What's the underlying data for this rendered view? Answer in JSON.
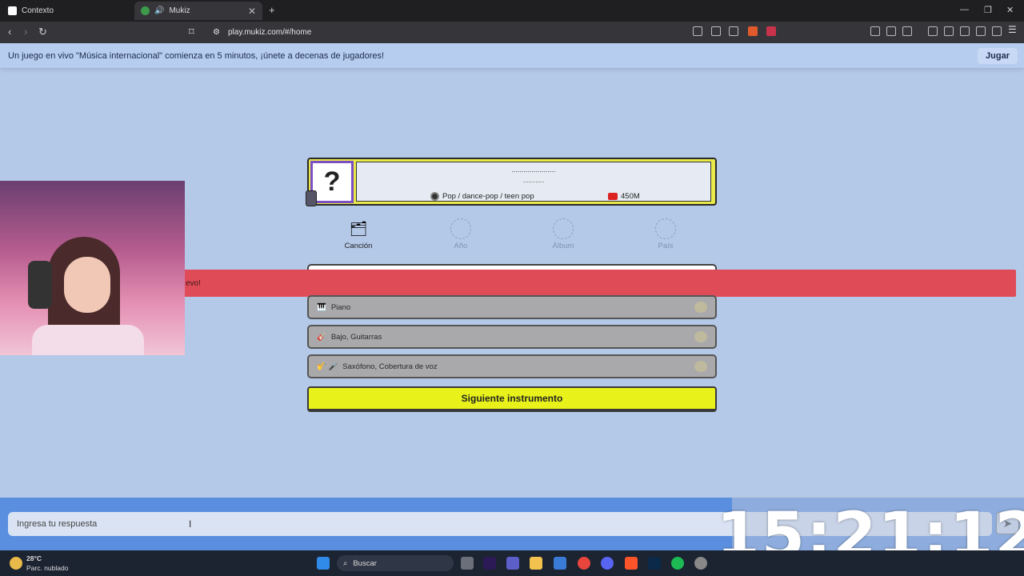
{
  "browser": {
    "tabs": [
      {
        "label": "Contexto",
        "active": false
      },
      {
        "label": "Mukiz",
        "active": true
      }
    ],
    "new_tab": "+",
    "url": "play.mukiz.com/#/home"
  },
  "banner": {
    "text": "Un juego en vivo \"Música internacional\" comienza en 5 minutos, ¡únete a decenas de jugadores!",
    "button": "Jugar"
  },
  "song": {
    "mystery": "?",
    "title_hidden": "......................",
    "artist_hidden": "............",
    "genre": "Pop / dance-pop / teen pop",
    "views": "450M"
  },
  "categories": [
    {
      "label": "Canción",
      "state": "revealed"
    },
    {
      "label": "Año",
      "state": "locked"
    },
    {
      "label": "Álbum",
      "state": "locked"
    },
    {
      "label": "País",
      "state": "locked"
    }
  ],
  "alert": {
    "text": "evo!"
  },
  "instruments": [
    {
      "label": "Piano",
      "icon": "🎹"
    },
    {
      "label": "Bajo, Guitarras",
      "icon": "🎸"
    },
    {
      "label": "Saxófono, Cobertura de voz",
      "icon": "🎷 🎤"
    }
  ],
  "next_button": "Siguiente instrumento",
  "answer": {
    "placeholder": "Ingresa tu respuesta",
    "send": "➤"
  },
  "clock": "15:21:12",
  "taskbar": {
    "weather_temp": "28°C",
    "weather_desc": "Parc. nublado",
    "search": "Buscar"
  },
  "colors": {
    "page_bg": "#b4c8e7",
    "accent_yellow": "#e8f21a",
    "alert_red": "#e04b58",
    "mystery_border": "#7d4fc4"
  }
}
